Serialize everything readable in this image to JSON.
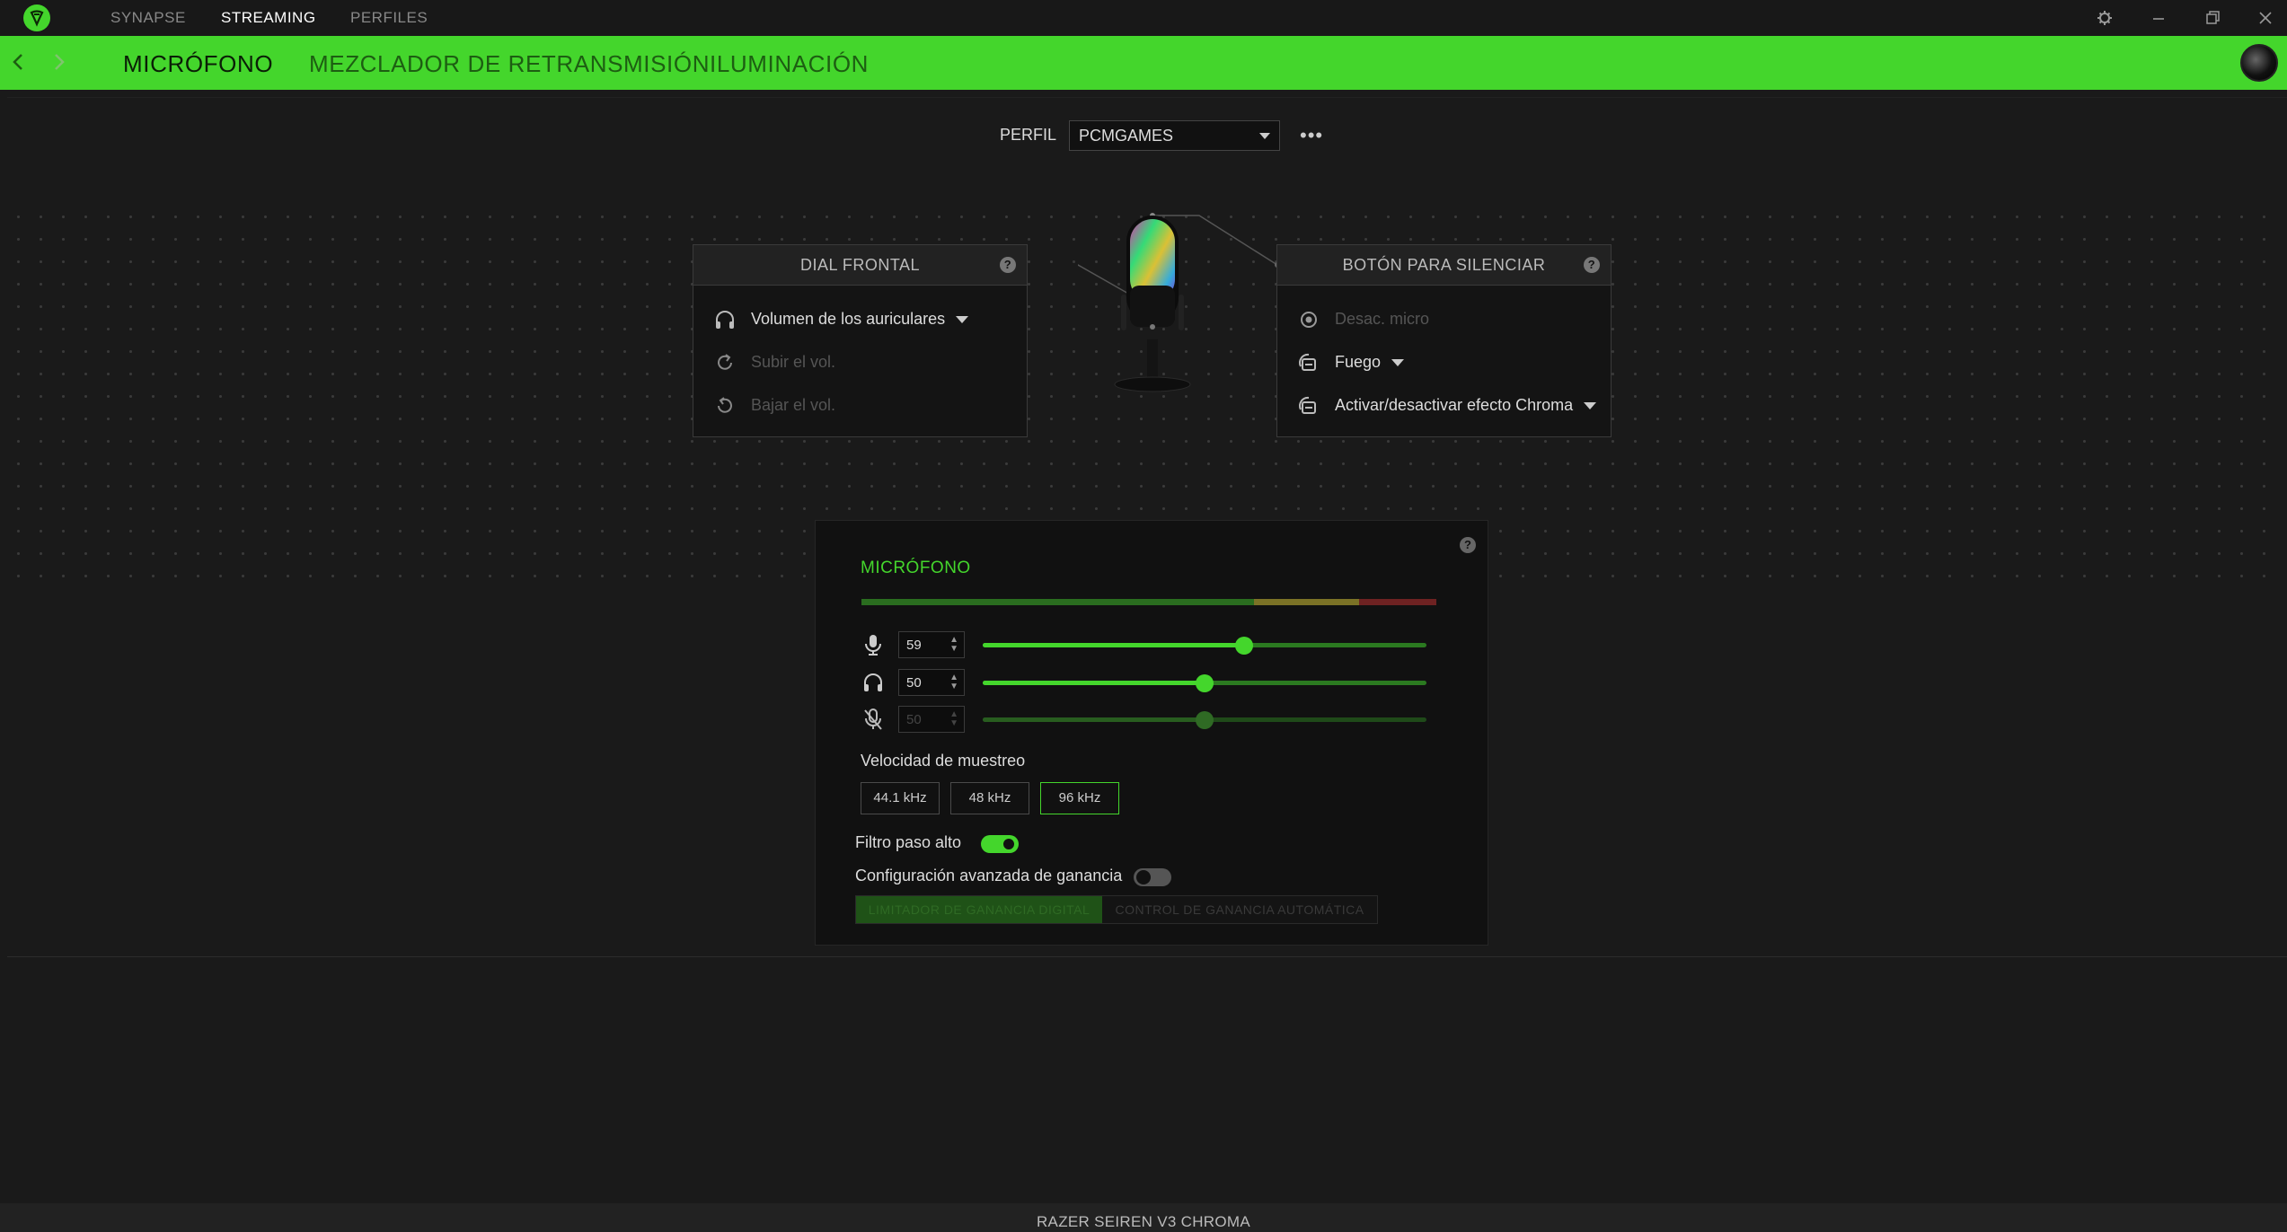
{
  "titlebar": {
    "tabs": [
      {
        "label": "SYNAPSE",
        "active": false
      },
      {
        "label": "STREAMING",
        "active": true
      },
      {
        "label": "PERFILES",
        "active": false
      }
    ],
    "icons": [
      "settings-icon",
      "minimize-icon",
      "restore-icon",
      "close-icon"
    ]
  },
  "nav": {
    "tabs": [
      {
        "label": "MICRÓFONO",
        "active": true
      },
      {
        "label": "MEZCLADOR DE RETRANSMISIÓN",
        "active": false
      },
      {
        "label": "ILUMINACIÓN",
        "active": false
      }
    ]
  },
  "profile": {
    "label": "PERFIL",
    "value": "PCMGAMES",
    "more": "•••"
  },
  "dial": {
    "title": "DIAL FRONTAL",
    "help": "?",
    "items": [
      {
        "label": "Volumen de los auriculares",
        "icon": "headphones-icon",
        "enabled": true
      },
      {
        "label": "Subir el vol.",
        "icon": "rotate-clockwise-icon",
        "enabled": false
      },
      {
        "label": "Bajar el vol.",
        "icon": "rotate-counterclockwise-icon",
        "enabled": false
      }
    ]
  },
  "mute": {
    "title": "BOTÓN PARA SILENCIAR",
    "help": "?",
    "items": [
      {
        "label": "Desac. micro",
        "icon": "radio-icon",
        "enabled": false
      },
      {
        "label": "Fuego",
        "icon": "chroma-effect-icon",
        "enabled": true
      },
      {
        "label": "Activar/desactivar efecto Chroma",
        "icon": "chroma-effect-icon",
        "enabled": true
      }
    ]
  },
  "mic_panel": {
    "title": "MICRÓFONO",
    "help": "?",
    "sliders": [
      {
        "icon": "microphone-icon",
        "value": "59",
        "level": 0.59,
        "enabled": true
      },
      {
        "icon": "headphones-icon",
        "value": "50",
        "level": 0.5,
        "enabled": true
      },
      {
        "icon": "mic-monitor-off-icon",
        "value": "50",
        "level": 0.5,
        "enabled": false
      }
    ],
    "sample_rate_label": "Velocidad de muestreo",
    "sample_rates": [
      {
        "label": "44.1 kHz",
        "selected": false
      },
      {
        "label": "48 kHz",
        "selected": false
      },
      {
        "label": "96 kHz",
        "selected": true
      }
    ],
    "high_pass_label": "Filtro paso alto",
    "high_pass_on": true,
    "advanced_gain_label": "Configuración avanzada de ganancia",
    "advanced_gain_on": false,
    "gain_tabs": [
      "LIMITADOR DE GANANCIA DIGITAL",
      "CONTROL DE GANANCIA AUTOMÁTICA"
    ]
  },
  "status": {
    "device": "RAZER SEIREN V3 CHROMA"
  },
  "colors": {
    "accent": "#44d62c",
    "background": "#1a1a1a"
  }
}
